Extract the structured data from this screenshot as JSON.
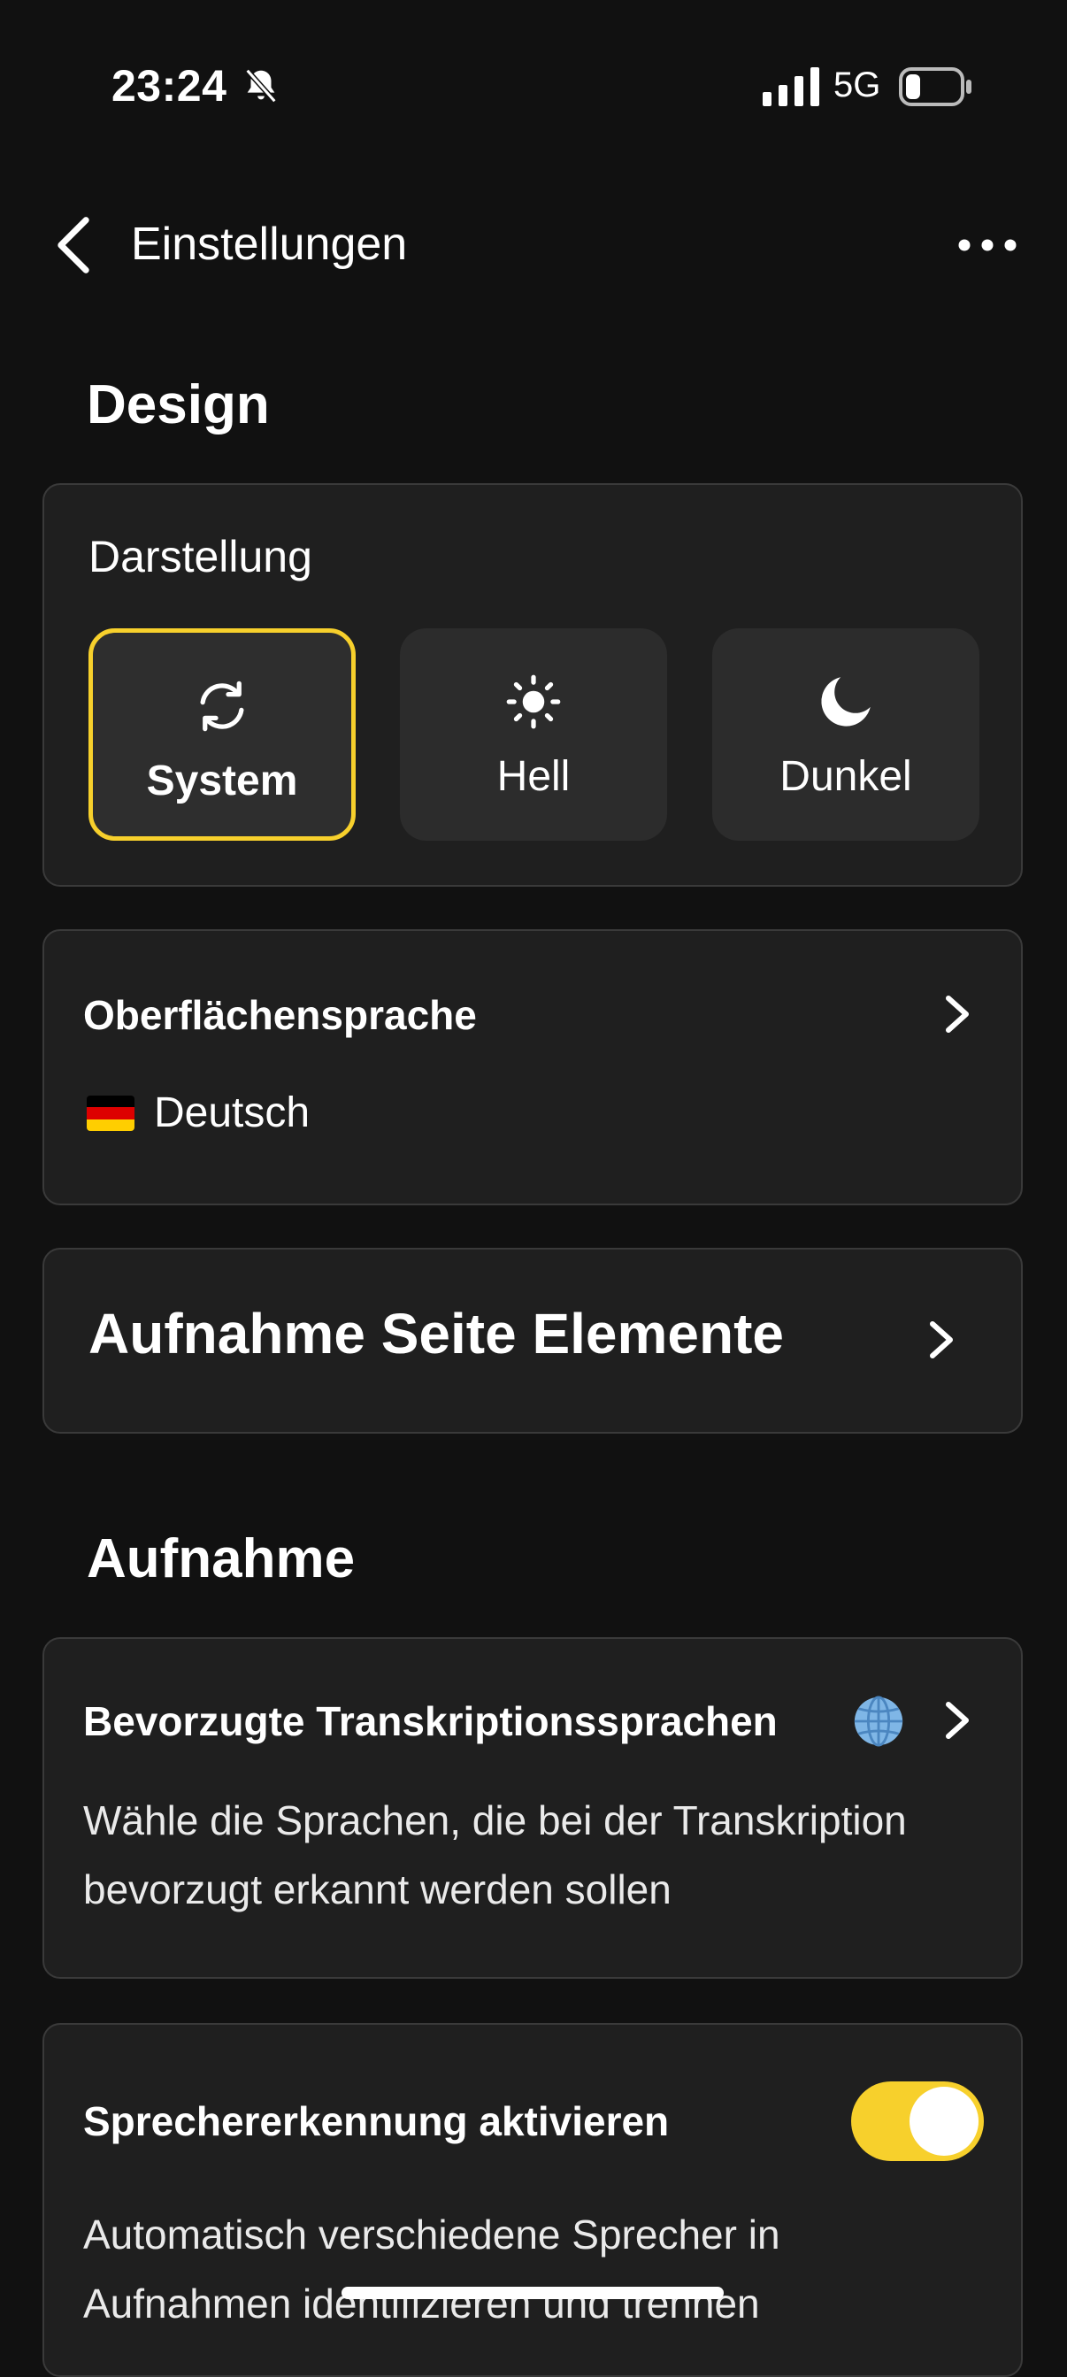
{
  "status_bar": {
    "time": "23:24",
    "network": "5G",
    "icons": [
      "bell-muted-icon",
      "signal-icon",
      "battery-icon"
    ]
  },
  "header": {
    "title": "Einstellungen",
    "icons": [
      "back-chevron-icon",
      "more-dots-icon"
    ]
  },
  "design_section": {
    "title": "Design",
    "appearance": {
      "label": "Darstellung",
      "options": [
        {
          "label": "System",
          "icon": "sync-icon",
          "selected": true
        },
        {
          "label": "Hell",
          "icon": "sun-icon",
          "selected": false
        },
        {
          "label": "Dunkel",
          "icon": "moon-icon",
          "selected": false
        }
      ]
    },
    "interface_language": {
      "title": "Oberflächensprache",
      "value": "Deutsch",
      "flag": "german-flag-icon"
    },
    "recording_page_elements": {
      "title": "Aufnahme Seite Elemente"
    }
  },
  "recording_section": {
    "title": "Aufnahme",
    "transcription_languages": {
      "title": "Bevorzugte Transkriptionssprachen",
      "description_line1": "Wähle die Sprachen, die bei der Transkription",
      "description_line2": "bevorzugt erkannt werden sollen",
      "icon": "globe-icon"
    },
    "speaker_recognition": {
      "title": "Sprechererkennung aktivieren",
      "enabled": true,
      "description_line1": "Automatisch verschiedene Sprecher in",
      "description_line2": "Aufnahmen identifizieren und trennen"
    }
  },
  "colors": {
    "background": "#111111",
    "card": "#1f1f1f",
    "accent": "#f7d02c"
  }
}
